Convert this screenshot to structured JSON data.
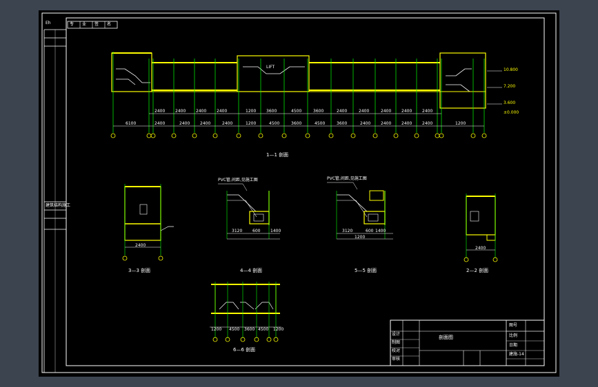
{
  "app": {
    "background": "#3c4450",
    "sheet_color": "#000000"
  },
  "colors": {
    "frame": "#ffffff",
    "wall": "#ffff00",
    "axis": "#00ff00",
    "dimension": "#ffffff",
    "marker": "#ffff00",
    "hatch": "#ff9999"
  },
  "left_strip": {
    "tag": "Eh",
    "small_label": "建筑结构施工"
  },
  "top_stamp": {
    "cells": [
      "专",
      "业",
      "签",
      "名"
    ]
  },
  "sections": {
    "s1_1": "1—1 剖面",
    "s3_3": "3—3 剖面",
    "s4_4": "4—4 剖面",
    "s5_5": "5—5 剖面",
    "s2_2": "2—2 剖面",
    "s6_6": "6—6 剖面"
  },
  "elevation_marks": [
    "±0.000",
    "3.600",
    "7.200",
    "10.800"
  ],
  "section1_dims": {
    "top_row": [
      "2400",
      "2400",
      "2400",
      "2400",
      "2400",
      "1200",
      "2400",
      "3600",
      "4500",
      "3600",
      "2400",
      "2400",
      "2400",
      "2400",
      "2400",
      "2400"
    ],
    "bottom_row": [
      "6100",
      "2400",
      "2400",
      "2400",
      "2400",
      "1200",
      "4500",
      "3600",
      "4500",
      "3600",
      "2400",
      "2400",
      "2400",
      "2400",
      "2400",
      "1200"
    ]
  },
  "section1_label_top": "LIFT",
  "section4_note": "PVC管,间距,见施工图",
  "section5_note": "PVC管,间距,见施工图",
  "section3_dim": "2400",
  "section2_dim": "2400",
  "section4_dims": [
    "3120",
    "600",
    "1400"
  ],
  "section5_dims": [
    "3120",
    "600",
    "1400",
    "1200"
  ],
  "section6_dims": [
    "1200",
    "4500",
    "3600",
    "4500",
    "1200"
  ],
  "title_block": {
    "drawing_name": "剖面图",
    "rows": [
      "设计",
      "制图",
      "校对",
      "审核"
    ],
    "right_rows": [
      "图号",
      "比例",
      "日期",
      "建施-14"
    ]
  }
}
